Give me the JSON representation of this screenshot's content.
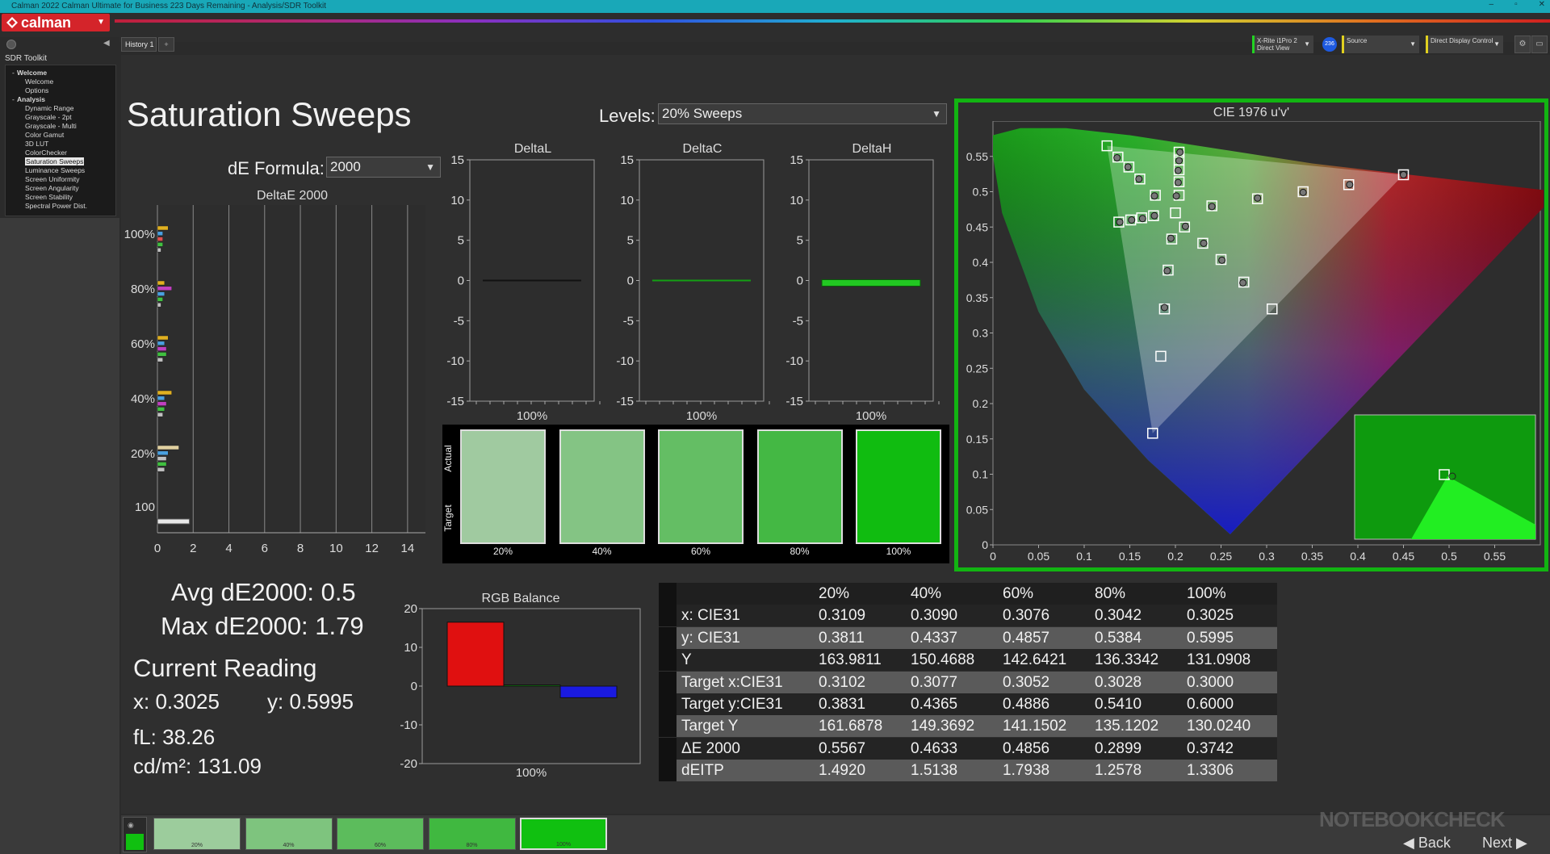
{
  "window": {
    "title": "Calman 2022 Calman Ultimate for Business 223 Days Remaining - Analysis/SDR Toolkit",
    "controls": [
      "–",
      "▫",
      "✕"
    ]
  },
  "app": {
    "logo": "calman"
  },
  "tabs": {
    "history": "History 1",
    "add": "+"
  },
  "devices": {
    "meter_line1": "X-Rite i1Pro 2",
    "meter_line2": "Direct View",
    "meter_badge": "236",
    "source": "Source",
    "display": "Direct Display Control"
  },
  "sidebar": {
    "title": "SDR Toolkit",
    "items": [
      {
        "label": "Welcome",
        "level": 0,
        "bold": true
      },
      {
        "label": "Welcome",
        "level": 1
      },
      {
        "label": "Options",
        "level": 1
      },
      {
        "label": "Analysis",
        "level": 0,
        "bold": true
      },
      {
        "label": "Dynamic Range",
        "level": 1
      },
      {
        "label": "Grayscale - 2pt",
        "level": 1
      },
      {
        "label": "Grayscale - Multi",
        "level": 1
      },
      {
        "label": "Color Gamut",
        "level": 1
      },
      {
        "label": "3D LUT",
        "level": 1
      },
      {
        "label": "ColorChecker",
        "level": 1
      },
      {
        "label": "Saturation Sweeps",
        "level": 1,
        "selected": true
      },
      {
        "label": "Luminance Sweeps",
        "level": 1
      },
      {
        "label": "Screen Uniformity",
        "level": 1
      },
      {
        "label": "Screen Angularity",
        "level": 1
      },
      {
        "label": "Screen Stability",
        "level": 1
      },
      {
        "label": "Spectral Power Dist.",
        "level": 1
      }
    ]
  },
  "page": {
    "title": "Saturation Sweeps",
    "de_formula_label": "dE Formula:",
    "de_formula_value": "2000",
    "levels_label": "Levels:",
    "levels_value": "20% Sweeps"
  },
  "deltae_chart": {
    "title": "DeltaE 2000",
    "y_labels": [
      "100%",
      "80%",
      "60%",
      "40%",
      "20%",
      "100"
    ],
    "x_ticks": [
      "0",
      "2",
      "4",
      "6",
      "8",
      "10",
      "12",
      "14"
    ],
    "bars_per_group": [
      {
        "colors": [
          "#e0b020",
          "#4aa0e0",
          "#e05050",
          "#40c040",
          "#c0c0c0"
        ],
        "values": [
          0.6,
          0.3,
          0.3,
          0.3,
          0.2
        ]
      },
      {
        "colors": [
          "#e0b020",
          "#c040c0",
          "#4aa0e0",
          "#40c040",
          "#c0c0c0"
        ],
        "values": [
          0.4,
          0.8,
          0.4,
          0.3,
          0.2
        ]
      },
      {
        "colors": [
          "#e0b020",
          "#4aa0e0",
          "#c040c0",
          "#40c040",
          "#c0c0c0"
        ],
        "values": [
          0.6,
          0.4,
          0.5,
          0.5,
          0.3
        ]
      },
      {
        "colors": [
          "#e0b020",
          "#4aa0e0",
          "#c040c0",
          "#40c040",
          "#c0c0c0"
        ],
        "values": [
          0.8,
          0.4,
          0.5,
          0.4,
          0.3
        ]
      },
      {
        "colors": [
          "#e0d0a0",
          "#4aa0e0",
          "#c0c0c0",
          "#40c040",
          "#c0c0c0"
        ],
        "values": [
          1.2,
          0.6,
          0.5,
          0.5,
          0.4
        ]
      }
    ],
    "gray_value": 1.79
  },
  "delta_charts": [
    {
      "title": "DeltaL",
      "xlabel": "100%",
      "y_ticks": [
        "15",
        "10",
        "5",
        "0",
        "-5",
        "-10",
        "-15"
      ],
      "value": 0.0,
      "color": "#111111"
    },
    {
      "title": "DeltaC",
      "xlabel": "100%",
      "y_ticks": [
        "15",
        "10",
        "5",
        "0",
        "-5",
        "-10",
        "-15"
      ],
      "value": 0.0,
      "color": "#14a014"
    },
    {
      "title": "DeltaH",
      "xlabel": "100%",
      "y_ticks": [
        "15",
        "10",
        "5",
        "0",
        "-5",
        "-10",
        "-15"
      ],
      "value": -0.4,
      "color": "#22c822"
    }
  ],
  "swatches": {
    "actual_label": "Actual",
    "target_label": "Target",
    "items": [
      {
        "label": "20%",
        "color": "#a0caa0"
      },
      {
        "label": "40%",
        "color": "#84c484"
      },
      {
        "label": "60%",
        "color": "#64be64"
      },
      {
        "label": "80%",
        "color": "#44b844"
      },
      {
        "label": "100%",
        "color": "#10bc10"
      }
    ]
  },
  "summary": {
    "avg": "Avg dE2000: 0.5",
    "max": "Max dE2000: 1.79",
    "current_reading": "Current Reading",
    "x": "x: 0.3025",
    "y": "y: 0.5995",
    "fl": "fL: 38.26",
    "cdm2": "cd/m²: 131.09"
  },
  "rgb_balance": {
    "title": "RGB Balance",
    "xlabel": "100%",
    "y_ticks": [
      "20",
      "10",
      "0",
      "-10",
      "-20"
    ],
    "values": [
      {
        "name": "R",
        "value": 16.5,
        "color": "#e01010"
      },
      {
        "name": "G",
        "value": 0.3,
        "color": "#10a010"
      },
      {
        "name": "B",
        "value": -3,
        "color": "#1a1ae0"
      }
    ]
  },
  "table": {
    "headers": [
      "",
      "20%",
      "40%",
      "60%",
      "80%",
      "100%"
    ],
    "rows": [
      [
        "x: CIE31",
        "0.3109",
        "0.3090",
        "0.3076",
        "0.3042",
        "0.3025"
      ],
      [
        "y: CIE31",
        "0.3811",
        "0.4337",
        "0.4857",
        "0.5384",
        "0.5995"
      ],
      [
        "Y",
        "163.9811",
        "150.4688",
        "142.6421",
        "136.3342",
        "131.0908"
      ],
      [
        "Target x:CIE31",
        "0.3102",
        "0.3077",
        "0.3052",
        "0.3028",
        "0.3000"
      ],
      [
        "Target y:CIE31",
        "0.3831",
        "0.4365",
        "0.4886",
        "0.5410",
        "0.6000"
      ],
      [
        "Target Y",
        "161.6878",
        "149.3692",
        "141.1502",
        "135.1202",
        "130.0240"
      ],
      [
        "ΔE 2000",
        "0.5567",
        "0.4633",
        "0.4856",
        "0.2899",
        "0.3742"
      ],
      [
        "dEITP",
        "1.4920",
        "1.5138",
        "1.7938",
        "1.2578",
        "1.3306"
      ]
    ]
  },
  "chart_data": {
    "type": "scatter",
    "title": "CIE 1976 u'v'",
    "x_ticks": [
      "0",
      "0.05",
      "0.1",
      "0.15",
      "0.2",
      "0.25",
      "0.3",
      "0.35",
      "0.4",
      "0.45",
      "0.5",
      "0.55"
    ],
    "y_ticks": [
      "0.55",
      "0.5",
      "0.45",
      "0.4",
      "0.35",
      "0.3",
      "0.25",
      "0.2",
      "0.15",
      "0.1",
      "0.05",
      "0"
    ],
    "xlim": [
      0,
      0.6
    ],
    "ylim": [
      0,
      0.6
    ],
    "targets": [
      [
        0.125,
        0.565
      ],
      [
        0.45,
        0.524
      ],
      [
        0.175,
        0.158
      ],
      [
        0.2,
        0.47
      ],
      [
        0.137,
        0.549
      ],
      [
        0.149,
        0.535
      ],
      [
        0.161,
        0.518
      ],
      [
        0.178,
        0.495
      ],
      [
        0.204,
        0.556
      ],
      [
        0.204,
        0.545
      ],
      [
        0.204,
        0.531
      ],
      [
        0.204,
        0.514
      ],
      [
        0.204,
        0.495
      ],
      [
        0.138,
        0.457
      ],
      [
        0.151,
        0.46
      ],
      [
        0.163,
        0.463
      ],
      [
        0.176,
        0.466
      ],
      [
        0.24,
        0.48
      ],
      [
        0.29,
        0.49
      ],
      [
        0.34,
        0.5
      ],
      [
        0.39,
        0.51
      ],
      [
        0.21,
        0.45
      ],
      [
        0.23,
        0.427
      ],
      [
        0.25,
        0.404
      ],
      [
        0.275,
        0.372
      ],
      [
        0.306,
        0.334
      ],
      [
        0.196,
        0.433
      ],
      [
        0.192,
        0.389
      ],
      [
        0.188,
        0.334
      ],
      [
        0.184,
        0.267
      ]
    ],
    "measured": [
      [
        0.136,
        0.548
      ],
      [
        0.148,
        0.535
      ],
      [
        0.16,
        0.518
      ],
      [
        0.177,
        0.494
      ],
      [
        0.205,
        0.556
      ],
      [
        0.204,
        0.544
      ],
      [
        0.203,
        0.53
      ],
      [
        0.203,
        0.513
      ],
      [
        0.201,
        0.494
      ],
      [
        0.139,
        0.457
      ],
      [
        0.152,
        0.46
      ],
      [
        0.164,
        0.462
      ],
      [
        0.177,
        0.466
      ],
      [
        0.24,
        0.479
      ],
      [
        0.29,
        0.491
      ],
      [
        0.34,
        0.499
      ],
      [
        0.391,
        0.51
      ],
      [
        0.45,
        0.524
      ],
      [
        0.211,
        0.451
      ],
      [
        0.231,
        0.427
      ],
      [
        0.251,
        0.403
      ],
      [
        0.274,
        0.371
      ],
      [
        0.195,
        0.434
      ],
      [
        0.191,
        0.388
      ],
      [
        0.188,
        0.336
      ]
    ]
  },
  "bottom": {
    "swatches": [
      {
        "label": "20%",
        "color": "#9ccc9c"
      },
      {
        "label": "40%",
        "color": "#7ec47e"
      },
      {
        "label": "60%",
        "color": "#5cbc5c"
      },
      {
        "label": "80%",
        "color": "#40b840"
      },
      {
        "label": "100%",
        "color": "#10c010"
      }
    ],
    "back": "Back",
    "next": "Next",
    "watermark": "NOTEBOOKCHECK"
  }
}
